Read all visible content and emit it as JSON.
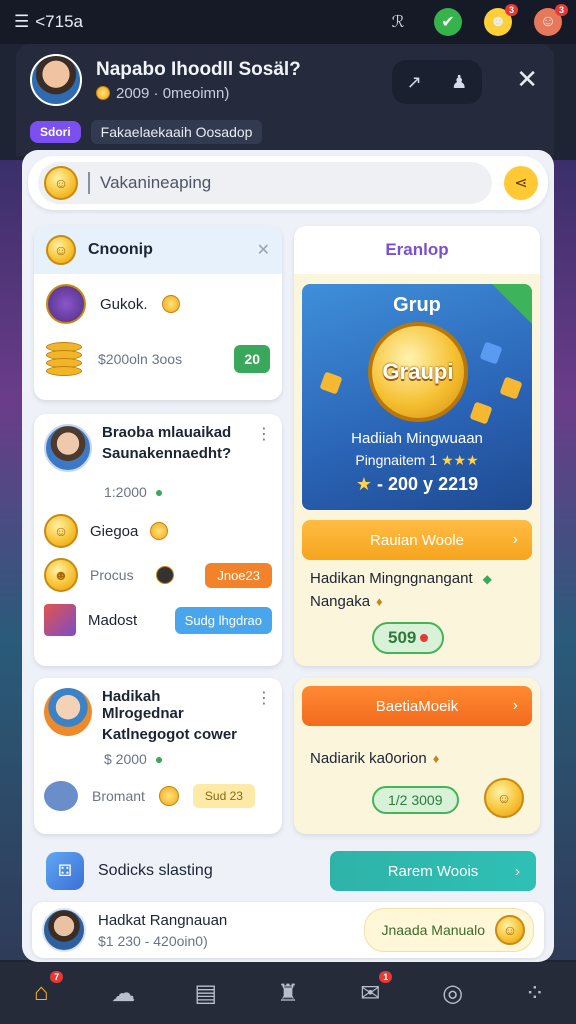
{
  "status_bar": {
    "menu_label": "<715a",
    "icons": [
      "menu-icon",
      "translate-icon",
      "check-icon",
      "notification-icon",
      "profile-icon"
    ],
    "badge_notification": "3",
    "badge_profile": "3"
  },
  "header": {
    "name": "Napabo Ihoodll Sosäl?",
    "subtitle": "2009 · 0meoimn)",
    "tag_pill": "Sdori",
    "tag_text": "Fakaelaekaaih Oosadop",
    "close": "✕"
  },
  "search": {
    "placeholder": "Vakanineaping"
  },
  "left_card_1": {
    "title": "Cnoonip",
    "item_label": "Gukok.",
    "amount": "$200oln 3oos",
    "chip": "20"
  },
  "left_card_2": {
    "title_line1": "Braoba mlauaikad",
    "title_line2": "Saunakennaedht?",
    "meta": "1:2000",
    "items": [
      {
        "label": "Giegoa"
      },
      {
        "label": "Procus",
        "chip": "Jnoe23"
      },
      {
        "label": "Madost",
        "chip": "Sudg lhgdrao"
      }
    ]
  },
  "left_card_3": {
    "title_line1": "Hadikah Mlrogednar",
    "title_line2": "Katlnegogot cower",
    "amount": "$ 2000",
    "item_label": "Bromant",
    "chip": "Sud 23"
  },
  "right_card_1": {
    "tab": "Eranlop",
    "banner_title": "Grup",
    "coin_text": "Graupi",
    "caption1": "Hadiiah Mingwuaan",
    "caption2": "Pingnaitem 1",
    "caption3": "- 200 y 2219",
    "button": "Rauian Woole",
    "desc_line1": "Hadikan Mingngnangant",
    "desc_line2": "Nangaka",
    "pill": "509"
  },
  "right_card_2": {
    "button": "BaetiaMoeik",
    "desc": "Nadiarik ka0orion",
    "pill": "1/2 3009"
  },
  "social": {
    "label": "Sodicks slasting",
    "button": "Rarem Woois"
  },
  "profile_bar": {
    "name": "Hadkat Rangnauan",
    "amount": "$1 230 - 420oin0)",
    "button": "Jnaada Manualo"
  },
  "nav": {
    "items": [
      "home-icon",
      "chat-icon",
      "shop-icon",
      "trophy-icon",
      "message-icon",
      "support-icon",
      "more-icon"
    ],
    "badge_home": "7",
    "badge_message": "1"
  }
}
